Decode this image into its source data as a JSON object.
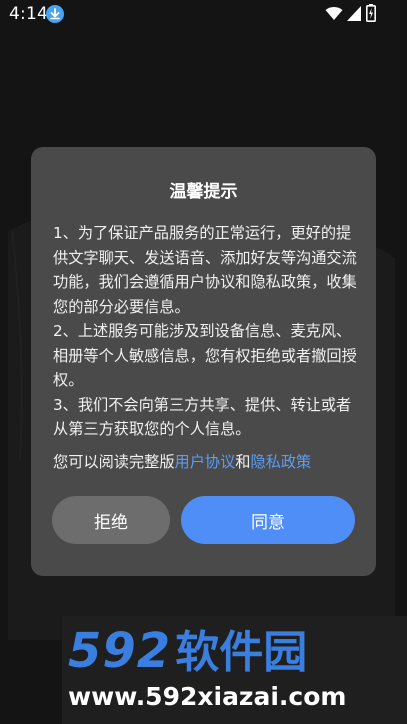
{
  "status_bar": {
    "time": "4:14",
    "icons": [
      "download-icon",
      "wifi-icon",
      "signal-icon",
      "battery-charging-icon"
    ]
  },
  "dialog": {
    "title": "温馨提示",
    "paragraphs": [
      "1、为了保证产品服务的正常运行，更好的提供文字聊天、发送语音、添加好友等沟通交流功能，我们会遵循用户协议和隐私政策，收集您的部分必要信息。",
      "2、上述服务可能涉及到设备信息、麦克风、相册等个人敏感信息，您有权拒绝或者撤回授权。",
      "3、我们不会向第三方共享、提供、转让或者从第三方获取您的个人信息。"
    ],
    "read_prefix": "您可以阅读完整版",
    "user_agreement_link": "用户协议",
    "conjunction": "和",
    "privacy_policy_link": "隐私政策",
    "refuse_label": "拒绝",
    "agree_label": "同意"
  },
  "watermark": {
    "logo_number": "592",
    "logo_text": "软件园",
    "url": "www.592xiazai.com"
  },
  "colors": {
    "background": "#141414",
    "dialog_bg": "#4a4a4a",
    "accent": "#4f8ef7",
    "link": "#5b9df5",
    "refuse_button": "#6d6d6d",
    "watermark_blue": "#3a7ee0"
  }
}
